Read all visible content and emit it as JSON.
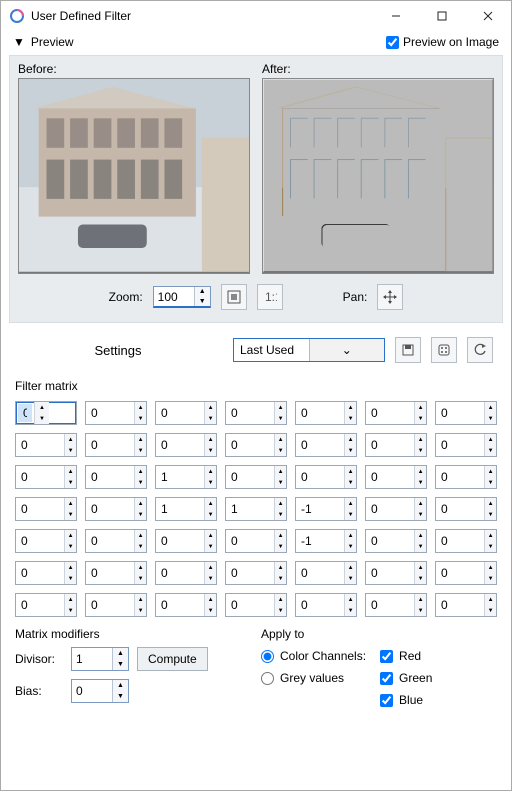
{
  "titlebar": {
    "title": "User Defined Filter"
  },
  "preview": {
    "toggle_label": "Preview",
    "on_image_label": "Preview on Image",
    "before_label": "Before:",
    "after_label": "After:",
    "zoom_label": "Zoom:",
    "zoom_value": "100",
    "pan_label": "Pan:"
  },
  "settings": {
    "label": "Settings",
    "selected": "Last Used"
  },
  "matrix": {
    "title": "Filter matrix",
    "rows": [
      [
        "0",
        "0",
        "0",
        "0",
        "0",
        "0",
        "0"
      ],
      [
        "0",
        "0",
        "0",
        "0",
        "0",
        "0",
        "0"
      ],
      [
        "0",
        "0",
        "1",
        "0",
        "0",
        "0",
        "0"
      ],
      [
        "0",
        "0",
        "1",
        "1",
        "-1",
        "0",
        "0"
      ],
      [
        "0",
        "0",
        "0",
        "0",
        "-1",
        "0",
        "0"
      ],
      [
        "0",
        "0",
        "0",
        "0",
        "0",
        "0",
        "0"
      ],
      [
        "0",
        "0",
        "0",
        "0",
        "0",
        "0",
        "0"
      ]
    ]
  },
  "modifiers": {
    "title": "Matrix modifiers",
    "divisor_label": "Divisor:",
    "divisor_value": "1",
    "compute_label": "Compute",
    "bias_label": "Bias:",
    "bias_value": "0"
  },
  "apply": {
    "title": "Apply to",
    "color_channels_label": "Color Channels:",
    "grey_label": "Grey values",
    "red_label": "Red",
    "green_label": "Green",
    "blue_label": "Blue"
  }
}
